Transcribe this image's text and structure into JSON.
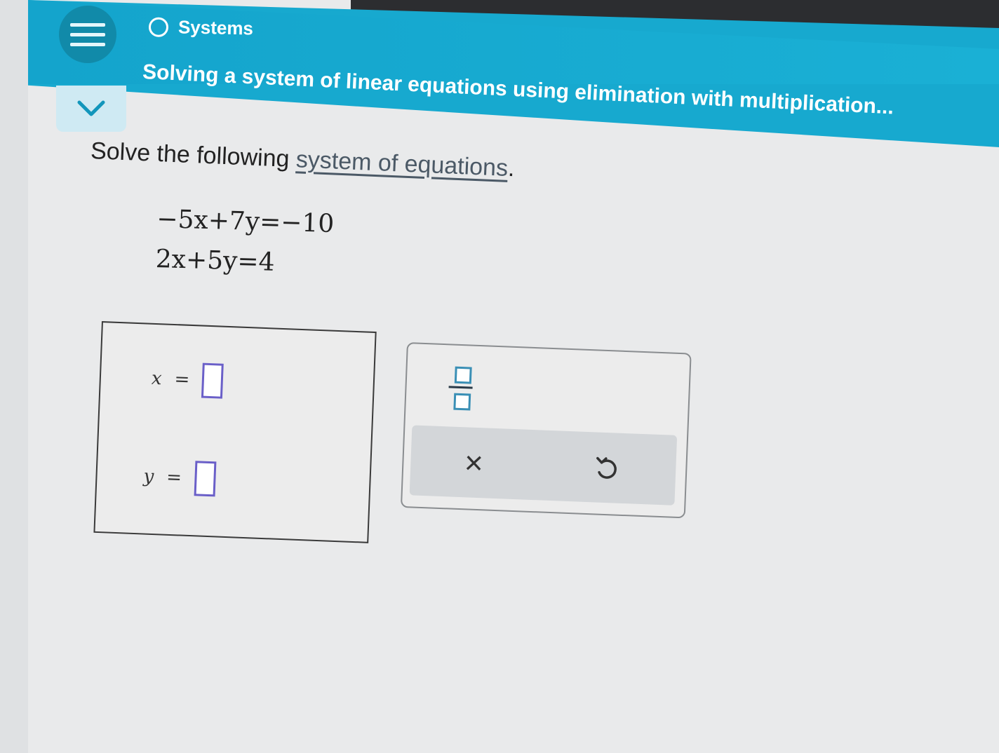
{
  "header": {
    "category": "Systems",
    "title": "Solving a system of linear equations using elimination with multiplication..."
  },
  "problem": {
    "prompt_text": "Solve the following ",
    "prompt_link": "system of equations",
    "prompt_end": ".",
    "equations": [
      "−5x+7y=−10",
      "2x+5y=4"
    ]
  },
  "answer": {
    "rows": [
      {
        "variable": "x",
        "equals": "="
      },
      {
        "variable": "y",
        "equals": "="
      }
    ]
  },
  "keypad": {
    "clear_symbol": "×",
    "undo_icon": "undo-icon",
    "fraction_icon": "fraction-icon"
  },
  "colors": {
    "header": "#17a9cf",
    "menu_button": "#118aa9",
    "input_border": "#6a5fc8",
    "fraction_accent": "#3a8fb5"
  }
}
